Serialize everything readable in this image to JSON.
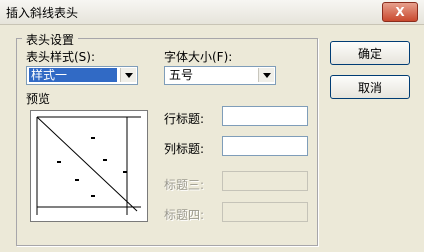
{
  "window": {
    "title": "插入斜线表头",
    "close_glyph": "X"
  },
  "group": {
    "legend": "表头设置"
  },
  "style": {
    "label": "表头样式(S):",
    "value": "样式一"
  },
  "font": {
    "label": "字体大小(F):",
    "value": "五号"
  },
  "preview": {
    "label": "预览"
  },
  "fields": {
    "row_title": {
      "label": "行标题:",
      "value": ""
    },
    "col_title": {
      "label": "列标题:",
      "value": ""
    },
    "title3": {
      "label": "标题三:",
      "value": ""
    },
    "title4": {
      "label": "标题四:",
      "value": ""
    }
  },
  "buttons": {
    "ok": "确定",
    "cancel": "取消"
  }
}
